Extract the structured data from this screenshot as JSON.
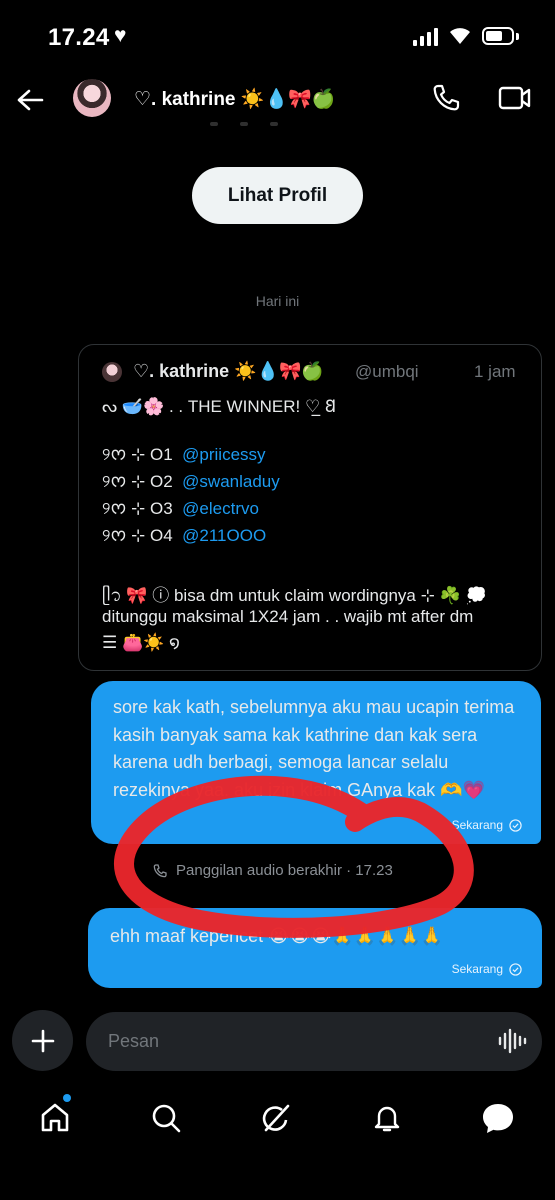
{
  "status_bar": {
    "time": "17.24",
    "heart": "♥"
  },
  "header": {
    "name": "♡. kathrine ☀️💧🎀🍏"
  },
  "profile_button": {
    "label": "Lihat Profil"
  },
  "date_separator": "Hari ini",
  "quoted_post": {
    "author_name": "♡. kathrine ☀️💧🎀🍏",
    "handle": "@umbqi",
    "time": "1 jam",
    "headline": "ᔓ 🥣🌸 . . THE WINNER! ♡̲ 𐐒",
    "winners": [
      {
        "number": "୨ᰔ ⊹ O1",
        "user": "@priicessy"
      },
      {
        "number": "୨ᰔ ⊹ O2",
        "user": "@swanladuy"
      },
      {
        "number": "୨ᰔ ⊹ O3",
        "user": "@electrvo"
      },
      {
        "number": "୨ᰔ ⊹ O4",
        "user": "@211OOO"
      }
    ],
    "note_line1": "ᥫ᭡ 🎀 ⓘ bisa dm untuk claim wordingnya ⊹ ☘️ 💭",
    "note_line2": "ditunggu maksimal 1X24 jam . . wajib mt after dm",
    "note_line3": "☰ 👛☀️ ໑"
  },
  "messages": [
    {
      "text": "sore kak kath, sebelumnya aku mau ucapin terima kasih banyak sama kak kathrine dan kak sera karena udh berbagi, semoga lancar selalu rezekinya yaa. aku izin klaim GAnya kak 🫶💗",
      "status": "Sekarang"
    },
    {
      "text": "ehh maaf kepencet 😭😭😭🙏🙏🙏🙏🙏",
      "status": "Sekarang"
    }
  ],
  "call_event": {
    "label": "Panggilan audio berakhir · 17.23"
  },
  "composer": {
    "placeholder": "Pesan"
  },
  "colors": {
    "accent": "#1d9bf0",
    "background": "#000000",
    "annotation": "#e8262b"
  }
}
